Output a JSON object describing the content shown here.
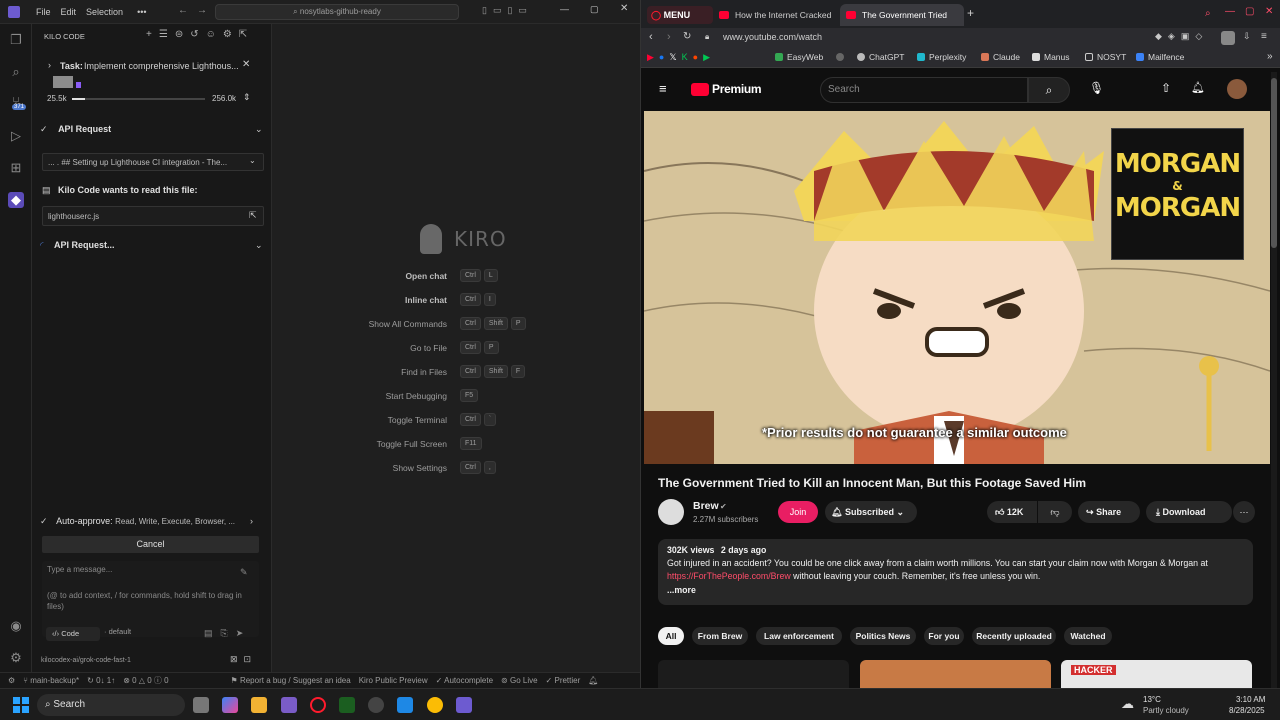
{
  "ide": {
    "menu": [
      "File",
      "Edit",
      "Selection"
    ],
    "more": "•••",
    "search": "nosytlabs-github-ready",
    "activity_badge": "371",
    "panel_title": "KILO CODE",
    "task": {
      "prefix": "Task:",
      "title": "Implement comprehensive Lighthous...",
      "tokens_left": "25.5k",
      "tokens_right": "256.0k",
      "progress_fraction": 0.1
    },
    "api_request_1": "API Request",
    "api_detail": "... . ## Setting up Lighthouse CI integration - The...",
    "read_title": "Kilo Code wants to read this file:",
    "read_file": "lighthouserc.js",
    "api_request_2": "API Request...",
    "auto_approve_label": "Auto-approve:",
    "auto_approve_value": "Read, Write, Execute, Browser, ...",
    "cancel": "Cancel",
    "message_placeholder": "Type a message...",
    "message_hint": "(@ to add context, / for commands, hold shift to drag in files)",
    "mode": "Code",
    "profile": "default",
    "model": "kilocodex-ai/grok-code-fast-1",
    "brand": "KIRO",
    "shortcuts": [
      {
        "label": "Open chat",
        "keys": [
          "Ctrl",
          "L"
        ],
        "bold": true
      },
      {
        "label": "Inline chat",
        "keys": [
          "Ctrl",
          "I"
        ],
        "bold": true
      },
      {
        "label": "Show All Commands",
        "keys": [
          "Ctrl",
          "Shift",
          "P"
        ],
        "bold": false
      },
      {
        "label": "Go to File",
        "keys": [
          "Ctrl",
          "P"
        ],
        "bold": false
      },
      {
        "label": "Find in Files",
        "keys": [
          "Ctrl",
          "Shift",
          "F"
        ],
        "bold": false
      },
      {
        "label": "Start Debugging",
        "keys": [
          "F5"
        ],
        "bold": false
      },
      {
        "label": "Toggle Terminal",
        "keys": [
          "Ctrl",
          "`"
        ],
        "bold": false
      },
      {
        "label": "Toggle Full Screen",
        "keys": [
          "F11"
        ],
        "bold": false
      },
      {
        "label": "Show Settings",
        "keys": [
          "Ctrl",
          ","
        ],
        "bold": false
      }
    ],
    "status": {
      "branch": "main-backup*",
      "sync": "0↓ 1↑",
      "errors": "0",
      "warnings": "0",
      "info": "0",
      "bug": "Report a bug / Suggest an idea",
      "preview": "Kiro Public Preview",
      "autocomplete": "Autocomplete",
      "golive": "Go Live",
      "prettier": "Prettier"
    }
  },
  "browser": {
    "tab_menu": "MENU",
    "tabs": [
      "How the Internet Cracked",
      "The Government Tried"
    ],
    "url": "www.youtube.com/watch",
    "bookmarks": [
      "EasyWeb",
      "ChatGPT",
      "Perplexity",
      "Claude",
      "Manus",
      "NOSYT",
      "Mailfence"
    ],
    "yt": {
      "logo": "Premium",
      "search_placeholder": "Search",
      "video_overlay": "*Prior results do not guarantee a similar outcome",
      "ad_line1": "MORGAN",
      "ad_amp": "&",
      "ad_line2": "MORGAN",
      "title": "The Government Tried to Kill an Innocent Man, But this Footage Saved Him",
      "channel": "Brew",
      "subscribers": "2.27M subscribers",
      "join": "Join",
      "subscribed": "Subscribed",
      "likes": "12K",
      "share": "Share",
      "download": "Download",
      "views": "302K views",
      "age": "2 days ago",
      "description": "Got injured in an accident? You could be one click away from a claim worth millions. You can start your claim now with Morgan & Morgan at",
      "link": "https://ForThePeople.com/Brew",
      "description2": "without leaving your couch. Remember, it's free unless you win.",
      "more": "...more",
      "chips": [
        "All",
        "From Brew",
        "Law enforcement",
        "Politics News",
        "For you",
        "Recently uploaded",
        "Watched"
      ],
      "thumb_badge": "HACKER"
    }
  },
  "taskbar": {
    "search": "Search",
    "weather_temp": "13°C",
    "weather_desc": "Partly cloudy",
    "time": "3:10 AM",
    "date": "8/28/2025"
  },
  "colors": {
    "accent_yt": "#ff0033",
    "join": "#e91e63",
    "link": "#3ea6ff",
    "kilo_purple": "#8b5cf6"
  }
}
